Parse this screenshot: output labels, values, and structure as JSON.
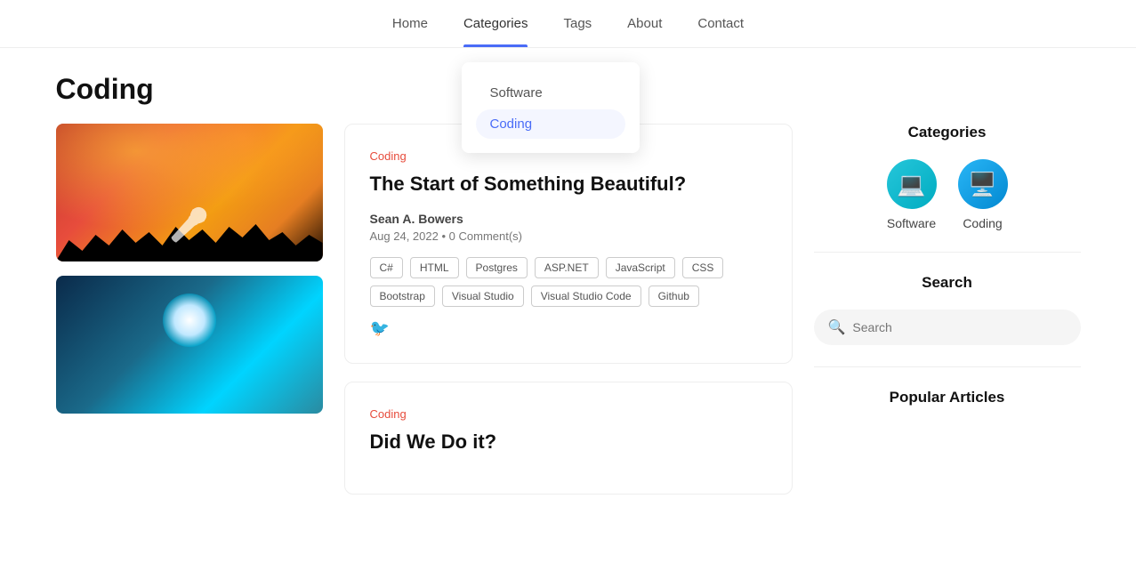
{
  "nav": {
    "items": [
      {
        "label": "Home",
        "active": false
      },
      {
        "label": "Categories",
        "active": true
      },
      {
        "label": "Tags",
        "active": false
      },
      {
        "label": "About",
        "active": false
      },
      {
        "label": "Contact",
        "active": false
      }
    ]
  },
  "dropdown": {
    "items": [
      {
        "label": "Software",
        "active": false
      },
      {
        "label": "Coding",
        "active": true
      }
    ]
  },
  "page": {
    "title": "Coding"
  },
  "articles": [
    {
      "category": "Coding",
      "title": "The Start of Something Beautiful?",
      "author": "Sean A. Bowers",
      "date": "Aug 24, 2022",
      "comments": "0 Comment(s)",
      "tags": [
        "C#",
        "HTML",
        "Postgres",
        "ASP.NET",
        "JavaScript",
        "CSS",
        "Bootstrap",
        "Visual Studio",
        "Visual Studio Code",
        "Github"
      ]
    },
    {
      "category": "Coding",
      "title": "Did We Do it?",
      "author": "",
      "date": "",
      "comments": "",
      "tags": []
    }
  ],
  "sidebar": {
    "categories_title": "Categories",
    "categories": [
      {
        "label": "Software",
        "icon": "💻"
      },
      {
        "label": "Coding",
        "icon": "🖥️"
      }
    ],
    "search_title": "Search",
    "search_placeholder": "Search",
    "popular_title": "Popular Articles"
  }
}
